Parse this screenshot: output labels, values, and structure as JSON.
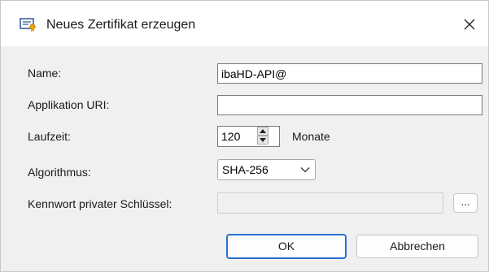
{
  "dialog": {
    "title": "Neues Zertifikat erzeugen"
  },
  "form": {
    "name_label": "Name:",
    "name_value": "ibaHD-API@",
    "app_uri_label": "Applikation URI:",
    "app_uri_value": "",
    "duration_label": "Laufzeit:",
    "duration_value": "120",
    "duration_unit": "Monate",
    "algorithm_label": "Algorithmus:",
    "algorithm_value": "SHA-256",
    "password_label": "Kennwort privater Schlüssel:",
    "password_value": "",
    "browse_label": "..."
  },
  "buttons": {
    "ok_label": "OK",
    "cancel_label": "Abbrechen"
  },
  "icons": {
    "title": "certificate-icon",
    "close": "close-icon",
    "spin_up": "spin-up-icon",
    "spin_down": "spin-down-icon",
    "dropdown": "chevron-down-icon"
  },
  "colors": {
    "default_button_border": "#2a6fd1",
    "dialog_background": "#f0f0f0"
  }
}
